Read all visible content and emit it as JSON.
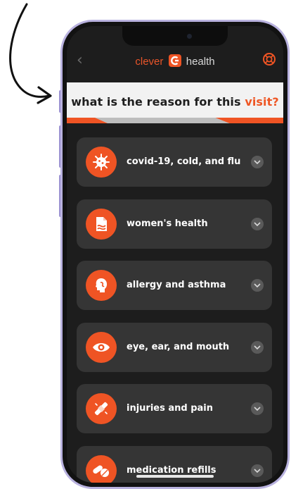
{
  "app": {
    "logo_left": "clever",
    "logo_right": "health"
  },
  "nav": {
    "back_glyph": "‹"
  },
  "question": {
    "prefix": "what is the reason for this ",
    "highlight": "visit?"
  },
  "reasons": [
    {
      "label": "covid-19, cold, and flu",
      "icon": "virus-icon"
    },
    {
      "label": "women's health",
      "icon": "womens-health-icon"
    },
    {
      "label": "allergy and asthma",
      "icon": "allergy-head-icon"
    },
    {
      "label": "eye, ear, and mouth",
      "icon": "eye-icon"
    },
    {
      "label": "injuries and pain",
      "icon": "bandage-icon"
    },
    {
      "label": "medication refills",
      "icon": "pills-icon"
    }
  ],
  "colors": {
    "accent": "#ef5424",
    "card": "#353535",
    "screen": "#1d1d1d",
    "frame": "#b9b2df"
  }
}
